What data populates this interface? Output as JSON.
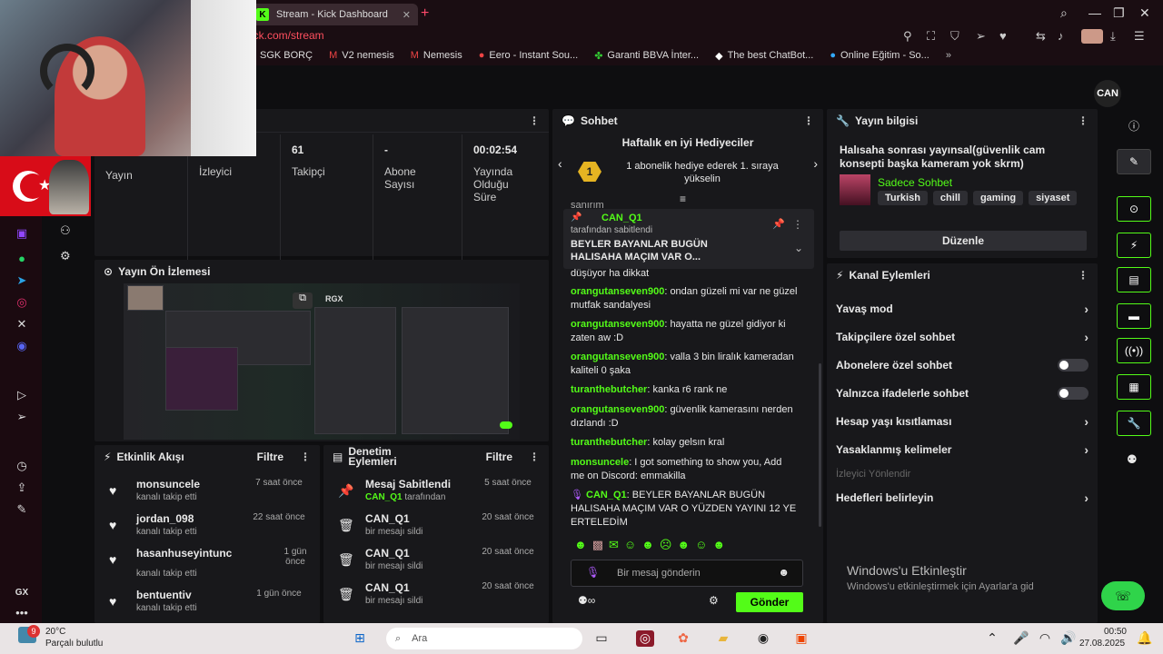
{
  "browser": {
    "tab_title": "Stream - Kick Dashboard",
    "url": "ick.com/stream",
    "bookmarks": [
      "SGK BORÇ",
      "V2 nemesis",
      "Nemesis",
      "Eero - Instant Sou...",
      "Garanti BBVA İnter...",
      "The best ChatBot...",
      "Online Eğitim - So..."
    ]
  },
  "left_sidebar": {
    "gx": "GX",
    "more": "•••"
  },
  "dashboard": {
    "avatar_label": "CAN"
  },
  "stats": [
    {
      "value": "",
      "label": "Yayın"
    },
    {
      "value": "",
      "label": "İzleyici"
    },
    {
      "value": "61",
      "label": "Takipçi"
    },
    {
      "value": "-",
      "label": "Abone Sayısı"
    },
    {
      "value": "00:02:54",
      "label": "Yayında Olduğu Süre"
    }
  ],
  "preview": {
    "title": "Yayın Ön İzlemesi",
    "rgx": "RGX"
  },
  "activity": {
    "title": "Etkinlik Akışı",
    "filter": "Filtre",
    "items": [
      {
        "name": "monsuncele",
        "sub": "kanalı takip etti",
        "time": "7 saat önce"
      },
      {
        "name": "jordan_098",
        "sub": "kanalı takip etti",
        "time": "22 saat önce"
      },
      {
        "name": "hasanhuseyintunc",
        "sub": "kanalı takip etti",
        "time": "1 gün önce"
      },
      {
        "name": "bentuentiv",
        "sub": "kanalı takip etti",
        "time": "1 gün önce"
      }
    ]
  },
  "mod_actions": {
    "title": "Denetim Eylemleri",
    "filter": "Filtre",
    "items": [
      {
        "name": "Mesaj Sabitlendi",
        "sub_user": "CAN_Q1",
        "sub": "tarafından",
        "time": "5 saat önce"
      },
      {
        "name": "CAN_Q1",
        "sub_user": "",
        "sub": "bir mesajı sildi",
        "time": "20 saat önce"
      },
      {
        "name": "CAN_Q1",
        "sub_user": "",
        "sub": "bir mesajı sildi",
        "time": "20 saat önce"
      },
      {
        "name": "CAN_Q1",
        "sub_user": "",
        "sub": "bir mesajı sildi",
        "time": "20 saat önce"
      }
    ]
  },
  "chat": {
    "title": "Sohbet",
    "gifter_title": "Haftalık en iyi Hediyeciler",
    "gifter_text": "1 abonelik hediye ederek 1. sıraya yükselin",
    "gifter_rank": "1",
    "cut_text": "sanırım",
    "pinned": {
      "user": "CAN_Q1",
      "by": "tarafından sabitlendi",
      "text": "BEYLER BAYANLAR BUGÜN HALISAHA MAÇIM VAR O..."
    },
    "prev_line": "düşüyor ha dikkat",
    "messages": [
      {
        "user": "orangutanseven900",
        "text": ": ondan güzeli mi var ne güzel mutfak sandalyesi"
      },
      {
        "user": "orangutanseven900",
        "text": ": hayatta ne güzel gidiyor ki zaten aw :D"
      },
      {
        "user": "orangutanseven900",
        "text": ": valla 3 bin liralık kameradan kaliteli 0 şaka"
      },
      {
        "user": "turanthebutcher",
        "text": ": kanka r6 rank ne"
      },
      {
        "user": "orangutanseven900",
        "text": ": güvenlik kamerasını nerden dızlandı :D"
      },
      {
        "user": "turanthebutcher",
        "text": ": kolay gelsın kral"
      },
      {
        "user": "monsuncele",
        "text": ": I got something to show you, Add me on Discord: emmakilla"
      },
      {
        "user": "CAN_Q1",
        "text": ": BEYLER BAYANLAR BUGÜN HALISAHA MAÇIM VAR O YÜZDEN YAYINI 12 YE ERTELEDİM"
      }
    ],
    "placeholder": "Bir mesaj gönderin",
    "send": "Gönder"
  },
  "stream_info": {
    "title": "Yayın bilgisi",
    "stream_title": "Halısaha sonrası yayınsal(güvenlik cam konsepti başka kameram yok skrm)",
    "category": "Sadece Sohbet",
    "tags": [
      "Turkish",
      "chill",
      "gaming",
      "siyaset"
    ],
    "edit": "Düzenle"
  },
  "channel_actions": {
    "title": "Kanal Eylemleri",
    "items": [
      {
        "label": "Yavaş mod",
        "kind": "chevron"
      },
      {
        "label": "Takipçilere özel sohbet",
        "kind": "chevron"
      },
      {
        "label": "Abonelere özel sohbet",
        "kind": "toggle"
      },
      {
        "label": "Yalnızca ifadelerle sohbet",
        "kind": "toggle"
      },
      {
        "label": "Hesap yaşı kısıtlaması",
        "kind": "chevron"
      },
      {
        "label": "Yasaklanmış kelimeler",
        "kind": "chevron"
      },
      {
        "label": "İzleyici Yönlendir",
        "kind": "disabled"
      },
      {
        "label": "Hedefleri belirleyin",
        "kind": "chevron"
      }
    ]
  },
  "watermark": {
    "line1": "Windows'u Etkinleştir",
    "line2": "Windows'u etkinleştirmek için Ayarlar'a gid"
  },
  "taskbar": {
    "badge": "9",
    "temp": "20°C",
    "weather": "Parçalı bulutlu",
    "search": "Ara",
    "time": "00:50",
    "date": "27.08.2025"
  },
  "colors": {
    "accent": "#53fc18",
    "panel": "#18181b",
    "bg": "#0e0e10"
  }
}
